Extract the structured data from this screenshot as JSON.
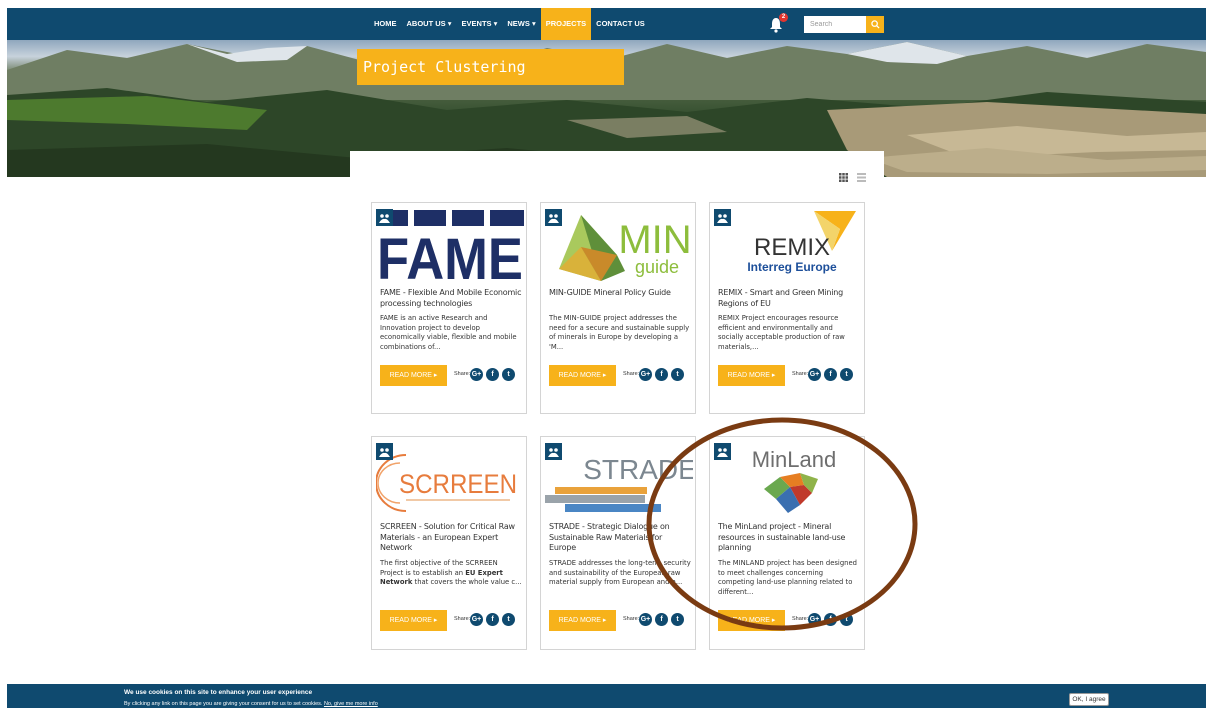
{
  "nav": {
    "items": [
      {
        "label": "HOME"
      },
      {
        "label": "ABOUT US ▾"
      },
      {
        "label": "EVENTS ▾"
      },
      {
        "label": "NEWS ▾"
      },
      {
        "label": "PROJECTS"
      },
      {
        "label": "CONTACT US"
      }
    ],
    "notification_count": "2",
    "search_placeholder": "Search",
    "icons": {
      "bell": "bell-icon",
      "search": "search-icon"
    }
  },
  "page": {
    "title": "Project Clustering"
  },
  "colors": {
    "navy": "#0f4a6f",
    "accent": "#f7b21a"
  },
  "cards": [
    {
      "logo_text": "FAME",
      "title": "FAME - Flexible And Mobile Economic processing technologies",
      "description": "FAME is an active Research and Innovation project to develop economically viable, flexible and mobile combinations of...",
      "read_more": "READ MORE",
      "share_label": "Share:"
    },
    {
      "logo_text": "MIN",
      "logo_sub": "guide",
      "title": "MIN-GUIDE Mineral Policy Guide",
      "description": "The MIN-GUIDE project addresses the need for a secure and sustainable supply of minerals in Europe by developing a 'M...",
      "read_more": "READ MORE",
      "share_label": "Share:"
    },
    {
      "logo_text": "REMIX",
      "logo_sub": "Interreg Europe",
      "title": "REMIX - Smart and Green Mining Regions of EU",
      "description": "REMIX Project encourages resource efficient and environmentally and socially acceptable production of raw materials,...",
      "read_more": "READ MORE",
      "share_label": "Share:"
    },
    {
      "logo_text": "SCRREEN",
      "title": "SCRREEN - Solution for Critical Raw Materials - an European Expert Network",
      "description_pre": "The first objective of the SCRREEN Project is to establish an ",
      "description_bold": "EU Expert Network",
      "description_post": " that covers the whole value c...",
      "read_more": "READ MORE",
      "share_label": "Share:"
    },
    {
      "logo_text": "STRADE",
      "title": "STRADE - Strategic Dialogue on Sustainable Raw Materials for Europe",
      "description": "STRADE addresses the long-term security and sustainability of the European raw material supply from European and n...",
      "read_more": "READ MORE",
      "share_label": "Share:"
    },
    {
      "logo_text": "MinLand",
      "title": "The MinLand project - Mineral resources in sustainable land-use planning",
      "description": "The MINLAND project has been designed to meet challenges concerning competing land-use planning related to different...",
      "read_more": "READ MORE",
      "share_label": "Share:"
    }
  ],
  "share_icons": [
    "G+",
    "f",
    "t"
  ],
  "cookie": {
    "title": "We use cookies on this site to enhance your user experience",
    "text": "By clicking any link on this page you are giving your consent for us to set cookies.",
    "link1": "No, give me more info",
    "ok": "OK, I agree"
  }
}
